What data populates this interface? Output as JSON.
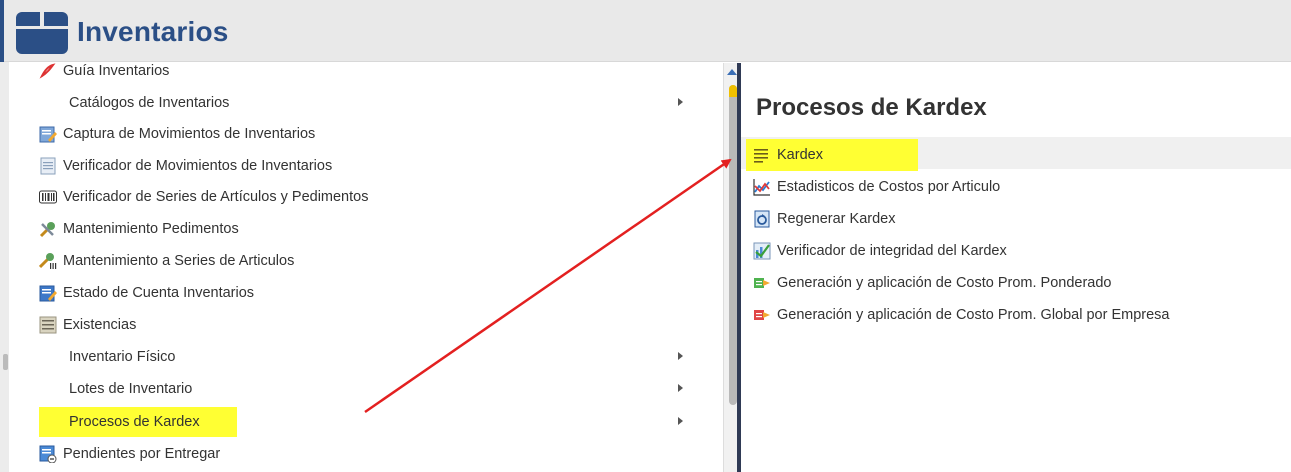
{
  "header": {
    "title": "Inventarios"
  },
  "left_menu": [
    {
      "label": "Guía Inventarios",
      "icon": "pdf-icon",
      "sub": false,
      "has_arrow": false
    },
    {
      "label": "Catálogos de Inventarios",
      "icon": "",
      "sub": true,
      "has_arrow": true
    },
    {
      "label": "Captura de Movimientos de Inventarios",
      "icon": "edit-form-icon",
      "sub": false,
      "has_arrow": false
    },
    {
      "label": "Verificador de Movimientos de Inventarios",
      "icon": "document-icon",
      "sub": false,
      "has_arrow": false
    },
    {
      "label": "Verificador de Series de Artículos y Pedimentos",
      "icon": "barcode-icon",
      "sub": false,
      "has_arrow": false
    },
    {
      "label": "Mantenimiento Pedimentos",
      "icon": "tools-icon",
      "sub": false,
      "has_arrow": false
    },
    {
      "label": "Mantenimiento a Series de Articulos",
      "icon": "tools-series-icon",
      "sub": false,
      "has_arrow": false
    },
    {
      "label": "Estado de Cuenta Inventarios",
      "icon": "edit-form-icon",
      "sub": false,
      "has_arrow": false
    },
    {
      "label": "Existencias",
      "icon": "list-icon",
      "sub": false,
      "has_arrow": false
    },
    {
      "label": "Inventario Físico",
      "icon": "",
      "sub": true,
      "has_arrow": true
    },
    {
      "label": "Lotes de Inventario",
      "icon": "",
      "sub": true,
      "has_arrow": true
    },
    {
      "label": "Procesos de Kardex",
      "icon": "",
      "sub": true,
      "has_arrow": true,
      "highlighted": true
    },
    {
      "label": "Pendientes por Entregar",
      "icon": "delivery-icon",
      "sub": false,
      "has_arrow": false
    }
  ],
  "right_panel": {
    "title": "Procesos de Kardex",
    "items": [
      {
        "label": "Kardex",
        "icon": "kardex-list-icon",
        "highlighted": true
      },
      {
        "label": "Estadisticos de Costos por Articulo",
        "icon": "chart-icon"
      },
      {
        "label": "Regenerar Kardex",
        "icon": "regenerate-icon"
      },
      {
        "label": "Verificador de integridad del Kardex",
        "icon": "check-chart-icon"
      },
      {
        "label": "Generación y aplicación de Costo Prom. Ponderado",
        "icon": "cost-green-icon"
      },
      {
        "label": "Generación y aplicación de Costo Prom. Global por Empresa",
        "icon": "cost-red-icon"
      }
    ]
  },
  "colors": {
    "title_blue": "#2b4f86",
    "highlight": "#ffff33",
    "annotation_arrow": "#e32020"
  }
}
